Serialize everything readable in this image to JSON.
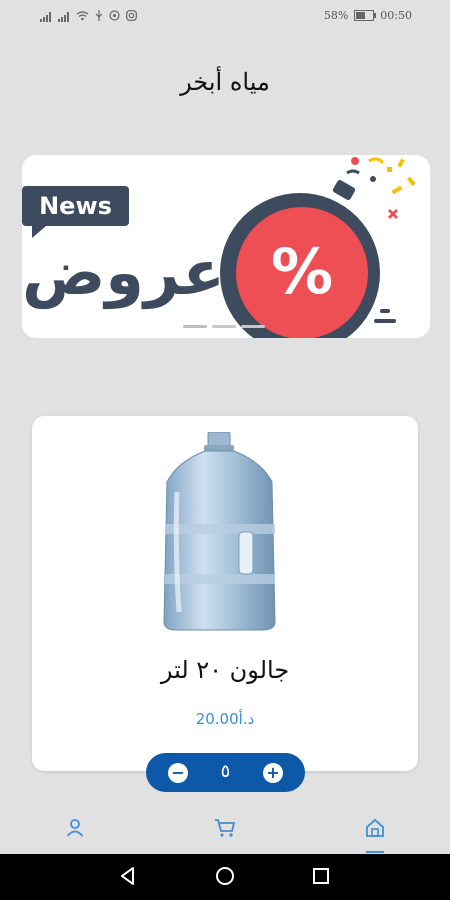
{
  "status_bar": {
    "battery": "58%",
    "time": "00:50",
    "battery_level": 0.58,
    "icons": [
      "signal-icon",
      "signal-icon",
      "wifi-icon",
      "usb-icon",
      "whatsapp-icon",
      "instagram-icon"
    ]
  },
  "header": {
    "title": "مياه أبخر"
  },
  "banner": {
    "news_label": "News",
    "offers_label": "عروض",
    "percent_symbol": "%",
    "indicator_count": 3,
    "active_indicator": 0
  },
  "product": {
    "name": "جالون ٢٠ لتر",
    "price": "20.00د.أ",
    "image": "water-gallon-bottle"
  },
  "quantity": {
    "minus_label": "−",
    "value": "٥",
    "plus_label": "+"
  },
  "bottom_nav": {
    "items": [
      {
        "name": "profile",
        "icon": "user-icon"
      },
      {
        "name": "cart",
        "icon": "cart-icon"
      },
      {
        "name": "home",
        "icon": "home-icon"
      }
    ],
    "active": "home"
  },
  "colors": {
    "background": "#e1e1e1",
    "brand_dark": "#3e4a5d",
    "badge_red": "#ee4f54",
    "stepper_blue": "#0e58a8",
    "accent": "#3e8ed8"
  }
}
